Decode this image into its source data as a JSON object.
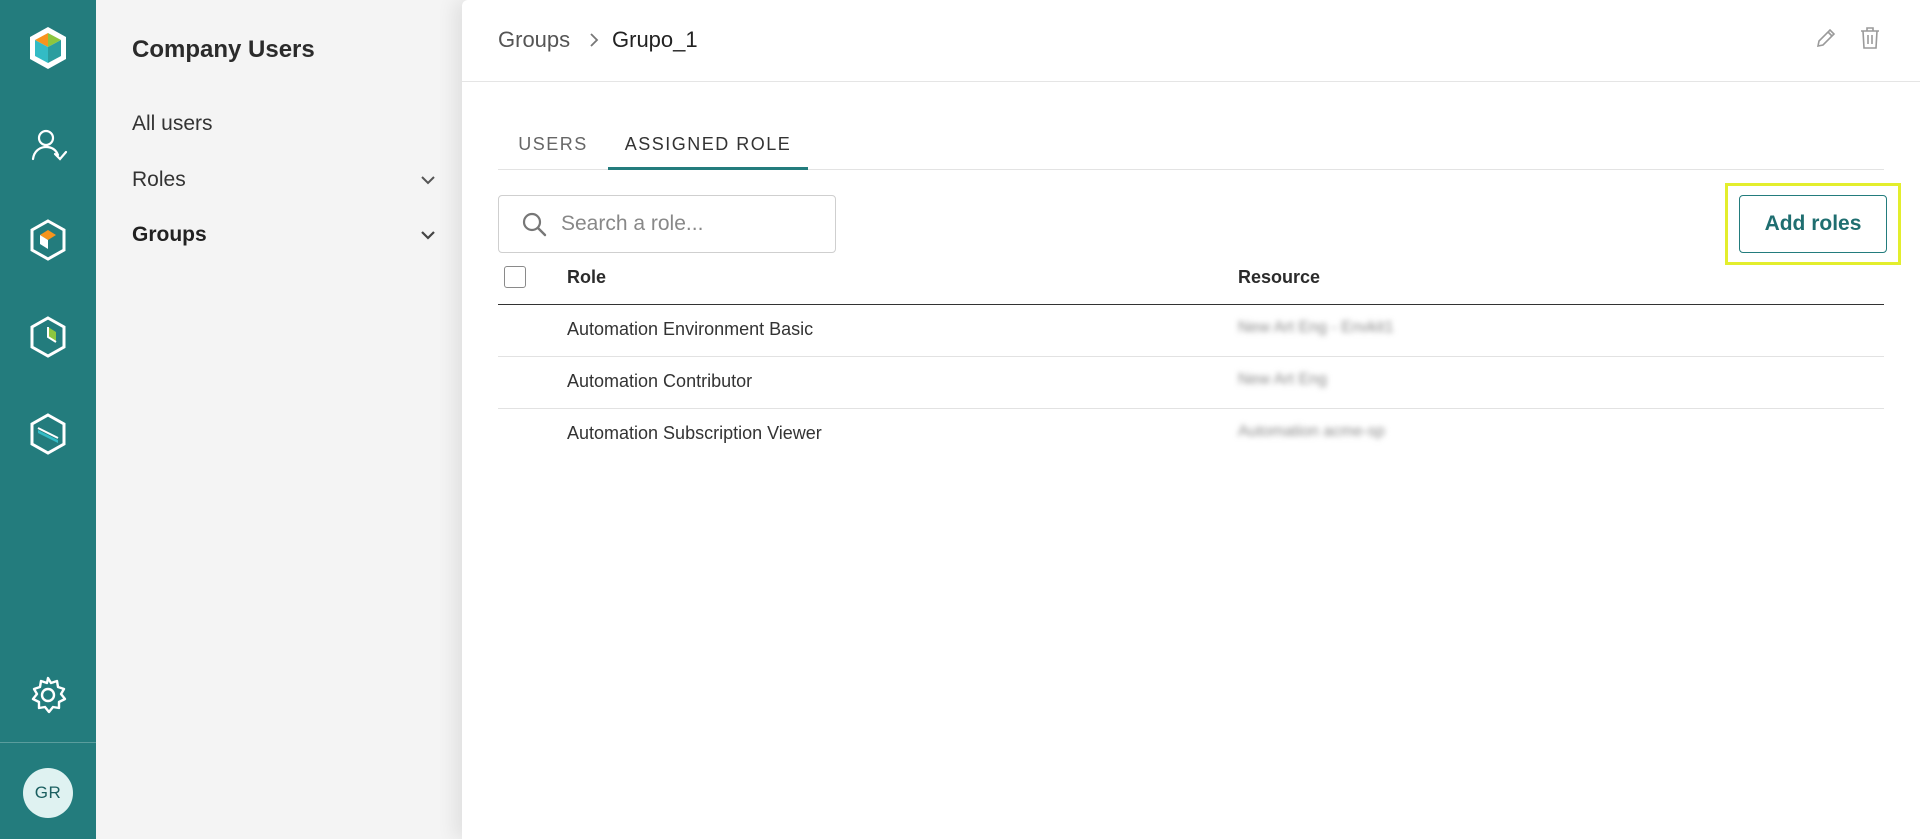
{
  "sidebar": {
    "user_initials": "GR"
  },
  "subnav": {
    "title": "Company Users",
    "items": [
      {
        "label": "All users"
      },
      {
        "label": "Roles"
      },
      {
        "label": "Groups"
      }
    ]
  },
  "header": {
    "breadcrumb_root": "Groups",
    "breadcrumb_current": "Grupo_1"
  },
  "tabs": [
    {
      "label": "USERS",
      "active": false
    },
    {
      "label": "ASSIGNED ROLE",
      "active": true
    }
  ],
  "search": {
    "placeholder": "Search a role..."
  },
  "actions": {
    "add_roles_label": "Add roles"
  },
  "table": {
    "columns": [
      "Role",
      "Resource"
    ],
    "rows": [
      {
        "role": "Automation Environment Basic",
        "resource": "New Art Eng - Envkit1"
      },
      {
        "role": "Automation Contributor",
        "resource": "New Art Eng"
      },
      {
        "role": "Automation Subscription Viewer",
        "resource": "Automation acme-sp"
      }
    ]
  },
  "colors": {
    "brand": "#237c7d",
    "highlight": "#e3ee2d"
  }
}
